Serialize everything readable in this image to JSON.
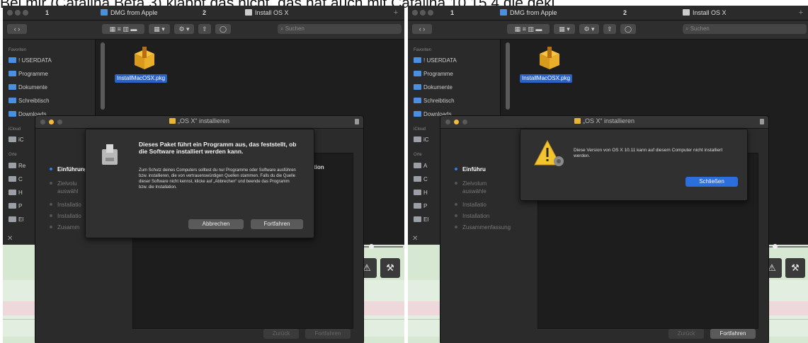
{
  "caption": "Bei mir (Catalina Beta 3) klappt das nicht, das hat auch mit Catalina 10.15.4 die gekl",
  "colors": {
    "traffic_red": "#f0584f",
    "traffic_yellow": "#f6b93b",
    "traffic_green": "#3ec24a",
    "selection_blue": "#2a62c8",
    "accent_blue": "#2a6fdb"
  },
  "left": {
    "tabs": [
      {
        "number": "1",
        "label": "DMG from Apple",
        "icon": "folder-icon"
      },
      {
        "number": "2",
        "label": "Install OS X",
        "icon": "disk-image-icon"
      }
    ],
    "toolbar": {
      "search_placeholder": "Suchen"
    },
    "sidebar": {
      "favorites_header": "Favoriten",
      "favorites": [
        "! USERDATA",
        "Programme",
        "Dokumente",
        "Schreibtisch",
        "Downloads"
      ],
      "icloud_header": "iCloud",
      "icloud_item": "iC",
      "places_header": "Orte",
      "places": [
        "Re",
        "C",
        "H",
        "P",
        "El"
      ]
    },
    "file": {
      "name": "InstallMacOSX.pkg",
      "icon": "package-icon"
    },
    "installer": {
      "title": "„OS X“ installieren",
      "steps": [
        "Einführung",
        "Zielvolu",
        "auswähl",
        "Installatio",
        "Installatio",
        "Zusamm"
      ],
      "partial_text": "tion",
      "back": "Zurück",
      "continue": "Fortfahren"
    },
    "dialog": {
      "title": "Dieses Paket führt ein Programm aus, das feststellt, ob die Software installiert werden kann.",
      "body": "Zum Schutz deines Computers solltest du nur Programme oder Software ausführen bzw. installieren, die von vertrauenswürdigen Quellen stammen. Falls du die Quelle dieser Software nicht kennst, klicke auf „Abbrechen“ und beende das Programm bzw. die Installation.",
      "cancel": "Abbrechen",
      "continue": "Fortfahren",
      "icon": "installer-package-icon"
    }
  },
  "right": {
    "tabs": [
      {
        "number": "1",
        "label": "DMG from Apple",
        "icon": "folder-icon"
      },
      {
        "number": "2",
        "label": "Install OS X",
        "icon": "disk-image-icon"
      }
    ],
    "toolbar": {
      "search_placeholder": "Suchen"
    },
    "sidebar": {
      "favorites_header": "Favoriten",
      "favorites": [
        "! USERDATA",
        "Programme",
        "Dokumente",
        "Schreibtisch",
        "Downloads"
      ],
      "icloud_header": "iCloud",
      "icloud_item": "iC",
      "places_header": "Orte",
      "places": [
        "A",
        "C",
        "H",
        "P",
        "El"
      ]
    },
    "file": {
      "name": "InstallMacOSX.pkg",
      "icon": "package-icon"
    },
    "installer": {
      "title": "„OS X“ installieren",
      "steps": [
        "Einführu",
        "Zielvolum",
        "auswähle",
        "Installatio",
        "Installation",
        "Zusammenfassung"
      ],
      "back": "Zurück",
      "continue": "Fortfahren"
    },
    "dialog": {
      "message": "Diese Version von OS X 10.11 kann auf diesem Computer nicht installiert werden.",
      "close": "Schließen",
      "icon": "warning-icon"
    }
  }
}
